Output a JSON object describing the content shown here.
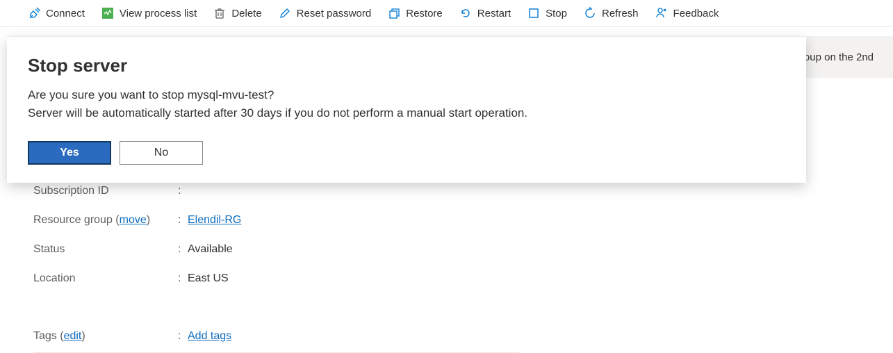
{
  "toolbar": {
    "connect": "Connect",
    "view_process_list": "View process list",
    "delete": "Delete",
    "reset_password": "Reset password",
    "restore": "Restore",
    "restart": "Restart",
    "stop": "Stop",
    "refresh": "Refresh",
    "feedback": "Feedback"
  },
  "banner": {
    "text_fragment": "oup on the 2nd"
  },
  "dialog": {
    "title": "Stop server",
    "line1": "Are you sure you want to stop mysql-mvu-test?",
    "line2": "Server will be automatically started after 30 days if you do not perform a manual start operation.",
    "yes": "Yes",
    "no": "No"
  },
  "details": {
    "subscription_id_label": "Subscription ID",
    "subscription_id_value": "",
    "resource_group_label": "Resource group",
    "resource_group_move": "move",
    "resource_group_value": "Elendil-RG",
    "status_label": "Status",
    "status_value": "Available",
    "location_label": "Location",
    "location_value": "East US",
    "tags_label": "Tags",
    "tags_edit": "edit",
    "tags_value": "Add tags"
  }
}
